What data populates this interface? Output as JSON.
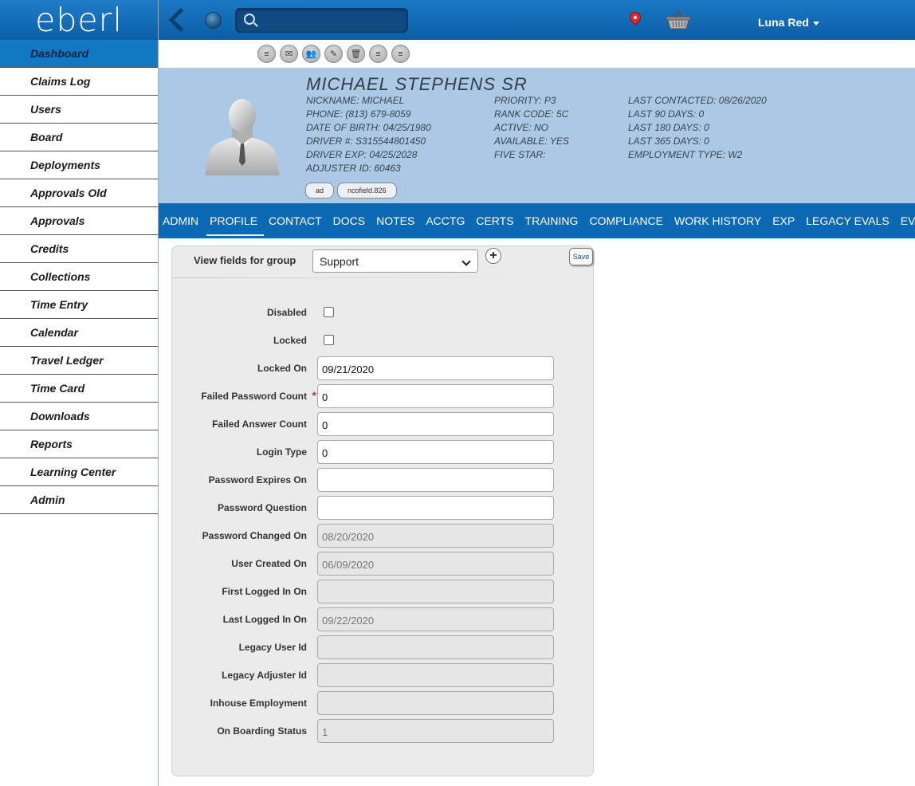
{
  "app": {
    "logo_text": "eberl"
  },
  "sidebar": {
    "items": [
      "Dashboard",
      "Claims Log",
      "Users",
      "Board",
      "Deployments",
      "Approvals Old",
      "Approvals",
      "Credits",
      "Collections",
      "Time Entry",
      "Calendar",
      "Travel Ledger",
      "Time Card",
      "Downloads",
      "Reports",
      "Learning Center",
      "Admin"
    ],
    "active": "Dashboard"
  },
  "topbar": {
    "user_name": "Luna Red",
    "search_placeholder": "",
    "icons": [
      "back-arrow-icon",
      "globe-icon",
      "search-icon",
      "map-pin-icon",
      "basket-icon"
    ]
  },
  "actions": {
    "icons": [
      "note-icon",
      "mail-icon",
      "people-icon",
      "edit-icon",
      "trash-icon",
      "note-icon",
      "note-icon"
    ]
  },
  "profile": {
    "name": "MICHAEL  STEPHENS  SR",
    "col1": [
      "NICKNAME: MICHAEL",
      "PHONE: (813) 679-8059",
      "DATE OF BIRTH: 04/25/1980",
      "DRIVER #: S315544801450",
      "DRIVER EXP: 04/25/2028",
      "ADJUSTER ID: 60463"
    ],
    "col2": [
      "PRIORITY: P3",
      "RANK CODE: 5C",
      "ACTIVE: NO",
      "AVAILABLE: YES",
      "FIVE STAR:"
    ],
    "col3": [
      "LAST CONTACTED: 08/26/2020",
      "LAST 90 DAYS: 0",
      "LAST 180 DAYS: 0",
      "LAST 365 DAYS: 0",
      "EMPLOYMENT TYPE: W2"
    ],
    "tags": [
      "ad",
      "ncofield.826"
    ]
  },
  "tabs": {
    "items": [
      "ADMIN",
      "PROFILE",
      "CONTACT",
      "DOCS",
      "NOTES",
      "ACCTG",
      "CERTS",
      "TRAINING",
      "COMPLIANCE",
      "WORK HISTORY",
      "EXP",
      "LEGACY EVALS",
      "EVALS"
    ],
    "active": "PROFILE"
  },
  "form": {
    "group_label": "View fields for group",
    "group_value": "Support",
    "save_label": "Save",
    "plus_label": "+",
    "fields": [
      {
        "label": "Disabled",
        "type": "checkbox",
        "value": false
      },
      {
        "label": "Locked",
        "type": "checkbox",
        "value": false
      },
      {
        "label": "Locked On",
        "type": "text",
        "value": "09/21/2020",
        "readonly": false
      },
      {
        "label": "Failed Password Count",
        "type": "text",
        "value": "0",
        "readonly": false,
        "required": true
      },
      {
        "label": "Failed Answer Count",
        "type": "text",
        "value": "0",
        "readonly": false
      },
      {
        "label": "Login Type",
        "type": "text",
        "value": "0",
        "readonly": false
      },
      {
        "label": "Password Expires On",
        "type": "text",
        "value": "",
        "readonly": false
      },
      {
        "label": "Password Question",
        "type": "text",
        "value": "",
        "readonly": false
      },
      {
        "label": "Password Changed On",
        "type": "text",
        "value": "08/20/2020",
        "readonly": true
      },
      {
        "label": "User Created On",
        "type": "text",
        "value": "06/09/2020",
        "readonly": true
      },
      {
        "label": "First Logged In On",
        "type": "text",
        "value": "",
        "readonly": true
      },
      {
        "label": "Last Logged In On",
        "type": "text",
        "value": "09/22/2020",
        "readonly": true
      },
      {
        "label": "Legacy User Id",
        "type": "text",
        "value": "",
        "readonly": true
      },
      {
        "label": "Legacy Adjuster Id",
        "type": "text",
        "value": "",
        "readonly": true
      },
      {
        "label": "Inhouse Employment",
        "type": "text",
        "value": "",
        "readonly": true
      },
      {
        "label": "On Boarding Status",
        "type": "text",
        "value": "1",
        "readonly": true
      }
    ]
  }
}
